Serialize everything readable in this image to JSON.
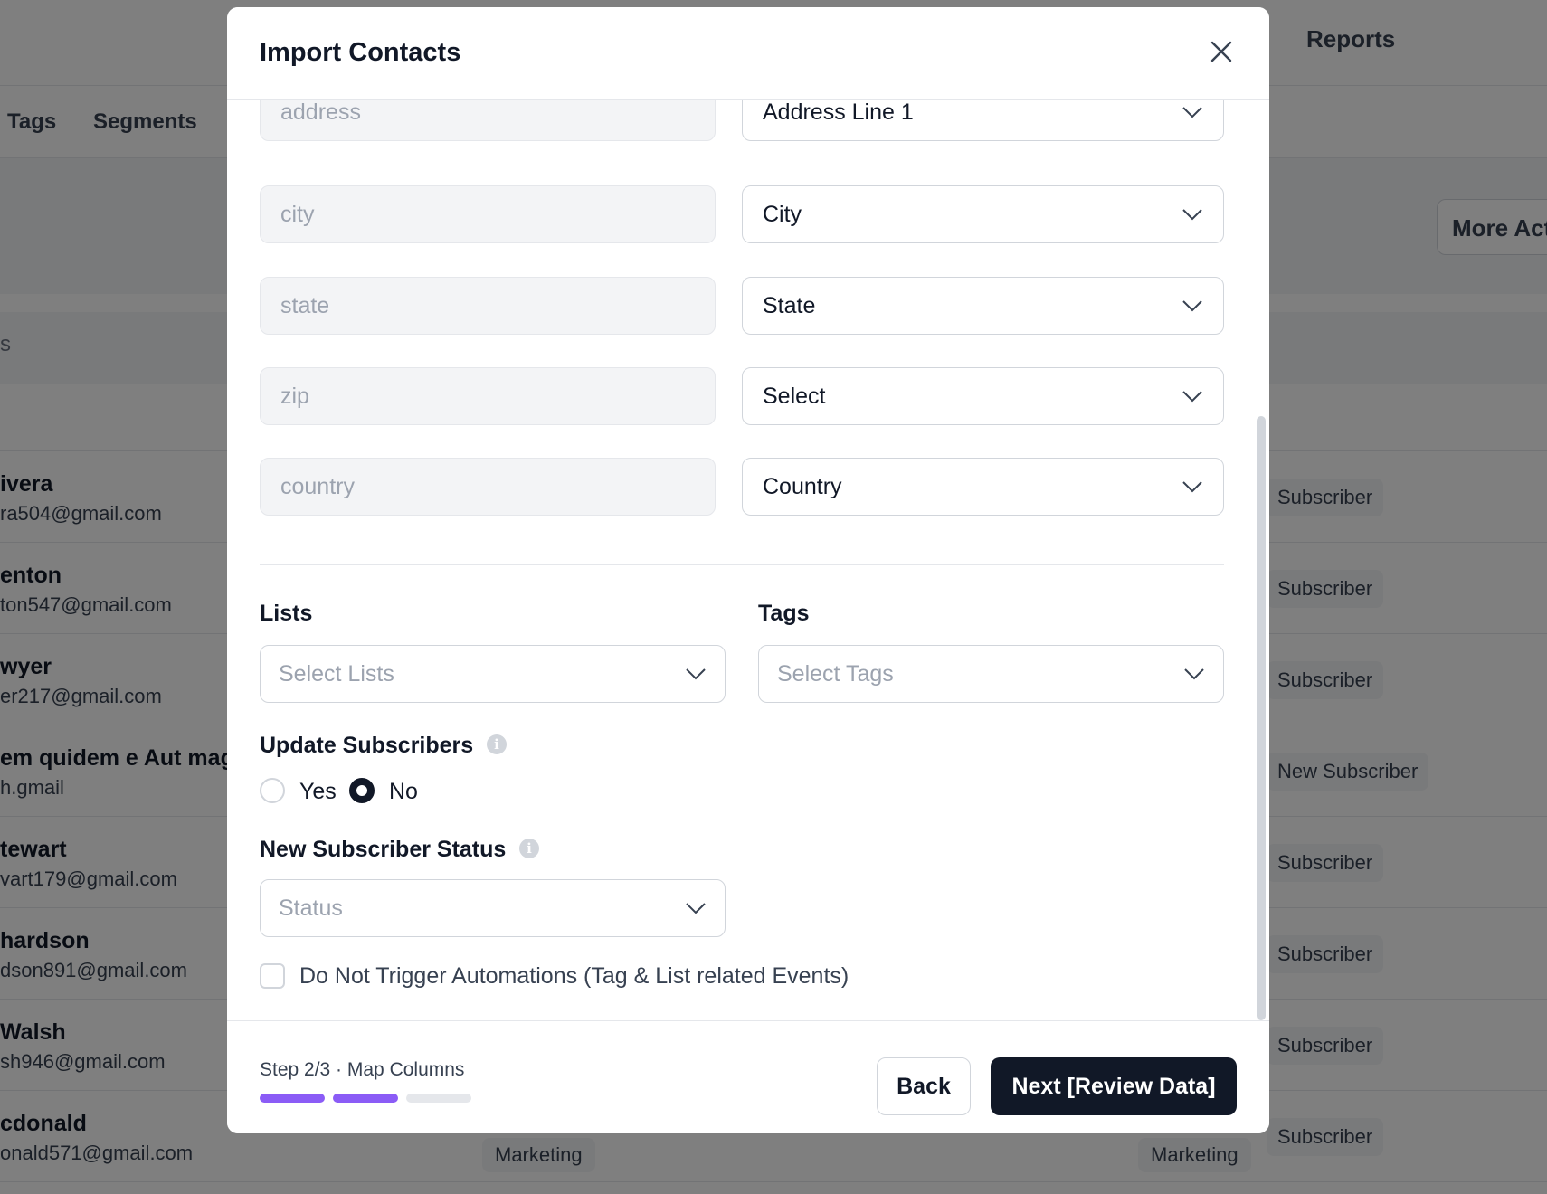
{
  "background": {
    "top_nav": {
      "reports": "Reports"
    },
    "sub_nav": {
      "tags": "Tags",
      "segments": "Segments"
    },
    "more_actions": "More Act",
    "table_header_fragment": "s",
    "rows": [
      {
        "name": "ivera",
        "email": "ra504@gmail.com",
        "status": "Subscriber"
      },
      {
        "name": "enton",
        "email": "ton547@gmail.com",
        "status": "Subscriber"
      },
      {
        "name": "wyer",
        "email": "er217@gmail.com",
        "status": "Subscriber"
      },
      {
        "name": "em quidem e Aut magn",
        "email": "h.gmail",
        "status": "New Subscriber"
      },
      {
        "name": "tewart",
        "email": "vart179@gmail.com",
        "status": "Subscriber"
      },
      {
        "name": "hardson",
        "email": "dson891@gmail.com",
        "status": "Subscriber"
      },
      {
        "name": "Walsh",
        "email": "sh946@gmail.com",
        "status": "Subscriber"
      },
      {
        "name": "cdonald",
        "email": "onald571@gmail.com",
        "status": "Subscriber",
        "tag_left": "Marketing",
        "tag_right": "Marketing"
      }
    ]
  },
  "modal": {
    "title": "Import Contacts",
    "mappings": [
      {
        "source": "address",
        "target": "Address Line 1"
      },
      {
        "source": "city",
        "target": "City"
      },
      {
        "source": "state",
        "target": "State"
      },
      {
        "source": "zip",
        "target": "Select"
      },
      {
        "source": "country",
        "target": "Country"
      }
    ],
    "lists": {
      "label": "Lists",
      "placeholder": "Select Lists"
    },
    "tags": {
      "label": "Tags",
      "placeholder": "Select Tags"
    },
    "update_subscribers": {
      "label": "Update Subscribers",
      "options": [
        {
          "label": "Yes",
          "selected": false
        },
        {
          "label": "No",
          "selected": true
        }
      ]
    },
    "new_subscriber_status": {
      "label": "New Subscriber Status",
      "placeholder": "Status"
    },
    "no_trigger": {
      "label": "Do Not Trigger Automations (Tag & List related Events)",
      "checked": false
    },
    "footer": {
      "step": "Step 2/3 · Map Columns",
      "steps_total": 3,
      "steps_done": 2,
      "back": "Back",
      "next": "Next [Review Data]"
    }
  },
  "colors": {
    "progress_active": "#8b5cf6",
    "progress_inactive": "#e5e7eb",
    "primary_button": "#111827"
  }
}
